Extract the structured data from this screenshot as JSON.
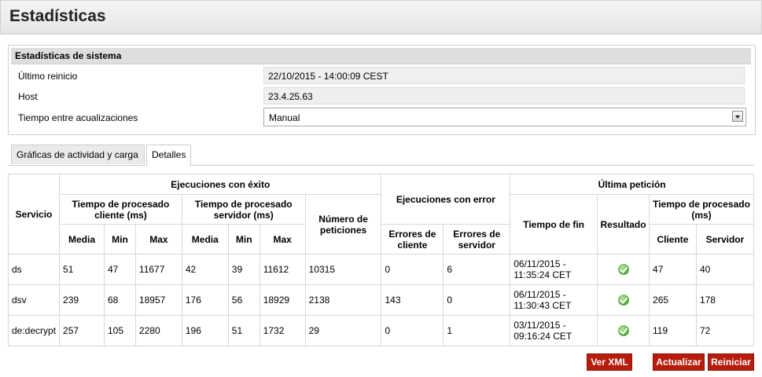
{
  "page": {
    "title": "Estadísticas"
  },
  "system": {
    "header": "Estadísticas de sistema",
    "rows": [
      {
        "label": "Último reinicio",
        "value": "22/10/2015 - 14:00:09 CEST"
      },
      {
        "label": "Host",
        "value": "23.4.25.63"
      },
      {
        "label": "Tiempo entre acualizaciones",
        "value": "Manual"
      }
    ]
  },
  "tabs": [
    {
      "label": "Gráficas de actividad y carga",
      "active": false
    },
    {
      "label": "Detalles",
      "active": true
    }
  ],
  "table": {
    "groups": {
      "service": "Servicio",
      "success": "Ejecuciones con éxito",
      "error": "Ejecuciones con error",
      "last": "Última petición"
    },
    "subgroups": {
      "client_time": "Tiempo de procesado cliente (ms)",
      "server_time": "Tiempo de procesado servidor (ms)",
      "requests": "Número de peticiones",
      "end_time": "Tiempo de fin",
      "result": "Resultado",
      "proc_time": "Tiempo de procesado (ms)"
    },
    "cols": {
      "media": "Media",
      "min": "Min",
      "max": "Max",
      "client_errors": "Errores de cliente",
      "server_errors": "Errores de servidor",
      "client": "Cliente",
      "server": "Servidor"
    },
    "rows": [
      {
        "service": "ds",
        "c_media": "51",
        "c_min": "47",
        "c_max": "11677",
        "s_media": "42",
        "s_min": "39",
        "s_max": "11612",
        "requests": "10315",
        "err_client": "0",
        "err_server": "6",
        "end_time": "06/11/2015 - 11:35:24 CET",
        "result": "ok",
        "p_client": "47",
        "p_server": "40"
      },
      {
        "service": "dsv",
        "c_media": "239",
        "c_min": "68",
        "c_max": "18957",
        "s_media": "176",
        "s_min": "56",
        "s_max": "18929",
        "requests": "2138",
        "err_client": "143",
        "err_server": "0",
        "end_time": "06/11/2015 - 11:30:43 CET",
        "result": "ok",
        "p_client": "265",
        "p_server": "178"
      },
      {
        "service": "de:decrypt",
        "c_media": "257",
        "c_min": "105",
        "c_max": "2280",
        "s_media": "196",
        "s_min": "51",
        "s_max": "1732",
        "requests": "29",
        "err_client": "0",
        "err_server": "1",
        "end_time": "03/11/2015 - 09:16:24 CET",
        "result": "ok",
        "p_client": "119",
        "p_server": "72"
      }
    ]
  },
  "buttons": {
    "xml": "Ver XML",
    "refresh": "Actualizar",
    "restart": "Reiniciar"
  },
  "colors": {
    "button_bg": "#b71c0c",
    "ok_icon": "#4ca43a"
  }
}
